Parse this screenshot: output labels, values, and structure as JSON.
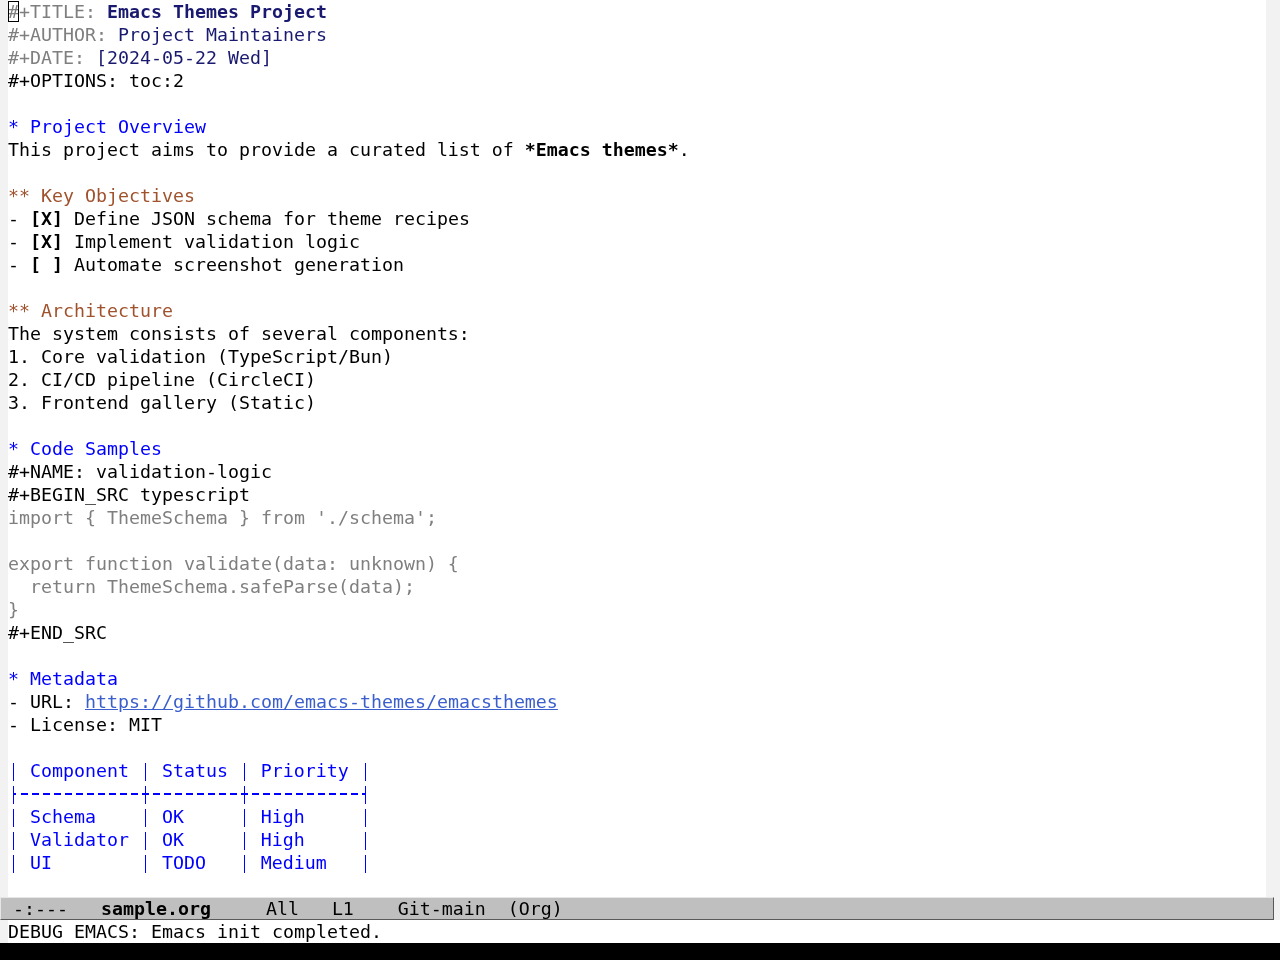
{
  "buffer": {
    "keywords": [
      {
        "kind": "title",
        "keyword": "#+TITLE:",
        "value": "Emacs Themes Project",
        "cursor": true
      },
      {
        "kind": "info",
        "keyword": "#+AUTHOR:",
        "value": "Project Maintainers",
        "cursor": false
      },
      {
        "kind": "info",
        "keyword": "#+DATE:",
        "value": "[2024-05-22 Wed]",
        "cursor": false
      },
      {
        "kind": "option",
        "keyword": "#+OPTIONS:",
        "value": "toc:2",
        "cursor": false
      }
    ],
    "outline": [
      {
        "marker": "*",
        "heading": "Project Overview",
        "blocks": [
          {
            "kind": "paragraph",
            "parts": [
              {
                "text": "This project aims to provide a curated list of ",
                "bold": false
              },
              {
                "text": "*Emacs themes*",
                "bold": true
              },
              {
                "text": ".",
                "bold": false
              }
            ]
          }
        ],
        "children": [
          {
            "marker": "**",
            "heading": "Key Objectives",
            "blocks": [
              {
                "kind": "checklist",
                "items": [
                  {
                    "bullet": "-",
                    "box": "[X]",
                    "text": "Define JSON schema for theme recipes"
                  },
                  {
                    "bullet": "-",
                    "box": "[X]",
                    "text": "Implement validation logic"
                  },
                  {
                    "bullet": "-",
                    "box": "[ ]",
                    "text": "Automate screenshot generation"
                  }
                ]
              }
            ]
          },
          {
            "marker": "**",
            "heading": "Architecture",
            "blocks": [
              {
                "kind": "paragraph",
                "parts": [
                  {
                    "text": "The system consists of several components:",
                    "bold": false
                  }
                ]
              },
              {
                "kind": "ordered",
                "items": [
                  {
                    "number": "1.",
                    "text": "Core validation (TypeScript/Bun)"
                  },
                  {
                    "number": "2.",
                    "text": "CI/CD pipeline (CircleCI)"
                  },
                  {
                    "number": "3.",
                    "text": "Frontend gallery (Static)"
                  }
                ]
              }
            ]
          }
        ]
      },
      {
        "marker": "*",
        "heading": "Code Samples",
        "blocks": [
          {
            "kind": "source",
            "name": "#+NAME: validation-logic",
            "begin": "#+BEGIN_SRC typescript",
            "code": "import { ThemeSchema } from './schema';\n\nexport function validate(data: unknown) {\n  return ThemeSchema.safeParse(data);\n}",
            "end": "#+END_SRC"
          }
        ]
      },
      {
        "marker": "*",
        "heading": "Metadata",
        "blocks": [
          {
            "kind": "list",
            "items": [
              {
                "kind": "link",
                "bullet": "-",
                "label": "URL:",
                "link": "https://github.com/emacs-themes/emacsthemes"
              },
              {
                "kind": "text",
                "bullet": "-",
                "label": "License: MIT"
              }
            ]
          },
          {
            "kind": "table",
            "columns": [
              "Component",
              "Status",
              "Priority"
            ],
            "rows": [
              [
                "Schema",
                "OK",
                "High"
              ],
              [
                "Validator",
                "OK",
                "High"
              ],
              [
                "UI",
                "TODO",
                "Medium"
              ]
            ]
          }
        ]
      }
    ]
  },
  "mode_line": {
    "status": "-:---",
    "buffer_name": "sample.org",
    "position": "All",
    "line": "L1",
    "vc": "Git-main",
    "mode": "(Org)"
  },
  "echo_area": {
    "message": "DEBUG EMACS: Emacs init completed."
  }
}
